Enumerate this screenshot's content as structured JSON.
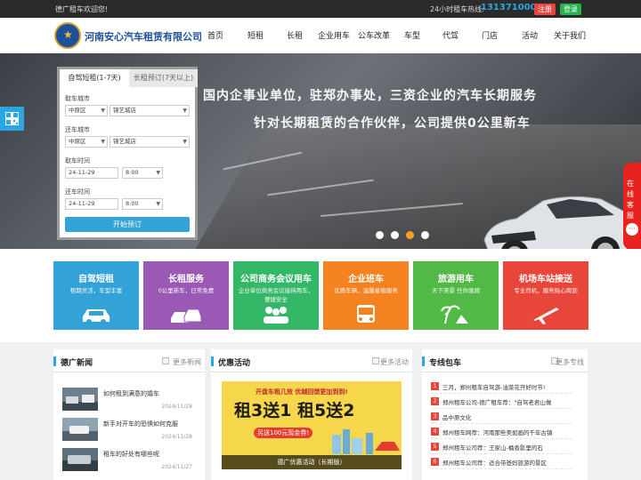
{
  "topbar": {
    "welcome": "德广租车欢迎您!",
    "hotline_label": "24小时租车热线:",
    "phone": "13137100009",
    "register": "注册",
    "login": "登录"
  },
  "header": {
    "company": "河南安心汽车租赁有限公司",
    "nav": [
      "首页",
      "短租",
      "长租",
      "企业用车",
      "公车改革",
      "车型",
      "代驾",
      "门店",
      "活动",
      "关于我们"
    ]
  },
  "banner": {
    "slogan1": "国内企事业单位，驻郑办事处，三资企业的汽车长期服务",
    "slogan2": "针对长期租赁的合作伙伴，公司提供0公里新车",
    "slides": [
      false,
      false,
      true,
      false
    ]
  },
  "booking": {
    "tab_active": "自驾短租(1-7天)",
    "tab_other": "长租预订(7天以上)",
    "pickup_city_label": "取车城市",
    "pickup_district": "中原区",
    "pickup_store": "锦艺城店",
    "return_city_label": "还车城市",
    "return_district": "中原区",
    "return_store": "锦艺城店",
    "pickup_time_label": "取车时间",
    "pickup_date": "24-11-29",
    "pickup_hour": "8:00",
    "return_time_label": "还车时间",
    "return_date": "24-11-29",
    "return_hour": "8:00",
    "submit": "开始预订"
  },
  "floats": {
    "customer_service": "在线客服",
    "chat_icon": "···"
  },
  "services": [
    {
      "title": "自驾短租",
      "sub": "租期灵活，车型丰富",
      "color": "#33a2d6",
      "icon": "car-icon"
    },
    {
      "title": "长租服务",
      "sub": "0公里新车，日常免费",
      "color": "#9b59b6",
      "icon": "cars-icon"
    },
    {
      "title": "公司商务会议用车",
      "sub": "企业单位商务会议接待用车，便捷安全",
      "color": "#34b767",
      "icon": "group-icon"
    },
    {
      "title": "企业班车",
      "sub": "优质车辆，温馨星级服务",
      "color": "#f58220",
      "icon": "bus-icon"
    },
    {
      "title": "旅游用车",
      "sub": "天下美景 任你驰骋",
      "color": "#52b947",
      "icon": "palm-icon"
    },
    {
      "title": "机场车站接送",
      "sub": "专业司机，服务贴心周到",
      "color": "#e8463b",
      "icon": "plane-icon"
    }
  ],
  "news": {
    "title": "德广新闻",
    "more": "更多新闻",
    "items": [
      {
        "title": "如何租到满意的婚车",
        "date": "2024/11/28"
      },
      {
        "title": "新手对开车的恐惧如何克服",
        "date": "2024/11/28"
      },
      {
        "title": "租车的好处有哪些呢",
        "date": "2024/11/27"
      }
    ]
  },
  "promo": {
    "title": "优惠活动",
    "more": "更多活动",
    "headline": "开盘车租几效  优越回馈更加到到!",
    "big": "租3送1 租5送2",
    "coupon": "另送100元现金券!",
    "caption": "德广优惠活动（长期版）"
  },
  "tours": {
    "title": "专线包车",
    "more": "更多专线",
    "items": [
      "三月，郑州租车自驾游-油菜花开好时节!",
      "郑州租车公司-德广租车荐：\"自驾老君山做",
      "品中原文化",
      "郑州租车网荐：河南那些美如画的千年古镇",
      "郑州租车公司荐：王家山-桶香影里的石",
      "郑州租车公司荐：适合带爸妈旅游的景区"
    ]
  }
}
